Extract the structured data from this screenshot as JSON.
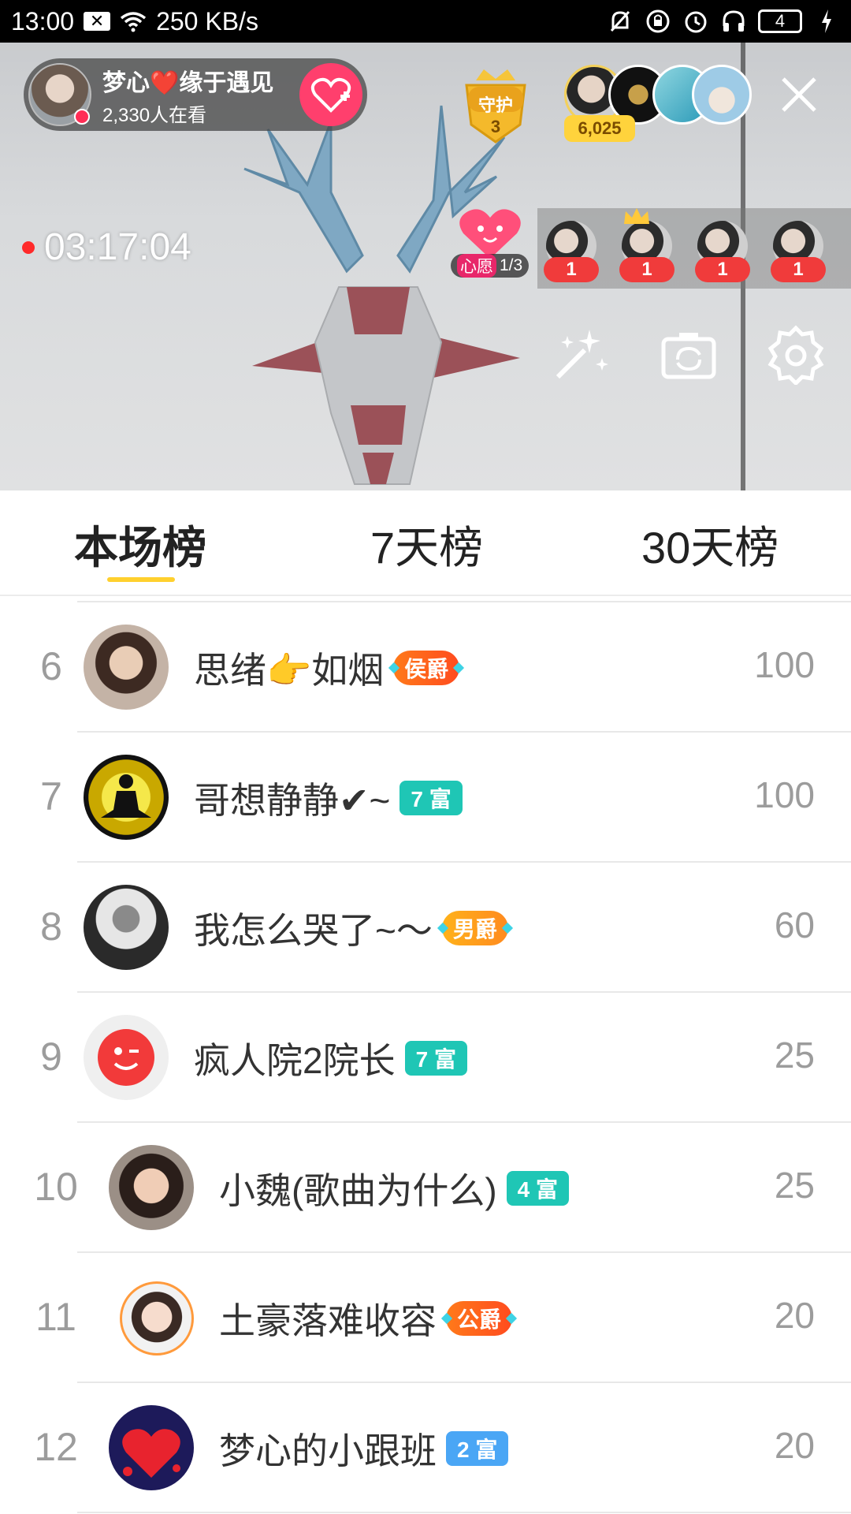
{
  "status_bar": {
    "time": "13:00",
    "net_speed": "250 KB/s",
    "battery": "4"
  },
  "host": {
    "name": "梦心❤️缘于遇见",
    "viewers": "2,330人在看"
  },
  "guard": {
    "label": "守护",
    "count": "3"
  },
  "audience": {
    "count": "6,025"
  },
  "timer": "03:17:04",
  "wish": {
    "label": "心愿",
    "progress": "1/3"
  },
  "gift_strip": [
    {
      "count": "1"
    },
    {
      "count": "1"
    },
    {
      "count": "1"
    },
    {
      "count": "1"
    }
  ],
  "tabs": {
    "current": "本场榜",
    "week": "7天榜",
    "month": "30天榜"
  },
  "ranking": [
    {
      "rank": "6",
      "name": "思绪👉如烟",
      "badge": "侯爵",
      "score": "100"
    },
    {
      "rank": "7",
      "name": "哥想静静✔~",
      "badge": "7 富",
      "score": "100"
    },
    {
      "rank": "8",
      "name": "我怎么哭了~〜",
      "badge": "男爵",
      "score": "60"
    },
    {
      "rank": "9",
      "name": "疯人院2院长",
      "badge": "7 富",
      "score": "25"
    },
    {
      "rank": "10",
      "name": "小魏(歌曲为什么)",
      "badge": "4 富",
      "score": "25"
    },
    {
      "rank": "11",
      "name": "土豪落难收容",
      "badge": "公爵",
      "score": "20"
    },
    {
      "rank": "12",
      "name": "梦心的小跟班",
      "badge": "2 富",
      "score": "20"
    }
  ],
  "icons": {
    "close": "close-icon",
    "beauty": "magic-wand-icon",
    "flip_camera": "flip-camera-icon",
    "settings": "gear-icon",
    "follow": "heart-plus-icon"
  },
  "colors": {
    "tab_underline": "#ffd02e",
    "rich_badge": "#1fc6b5",
    "noble_badge": "#ff5a1f",
    "follow_button": "#ff3f6d"
  }
}
